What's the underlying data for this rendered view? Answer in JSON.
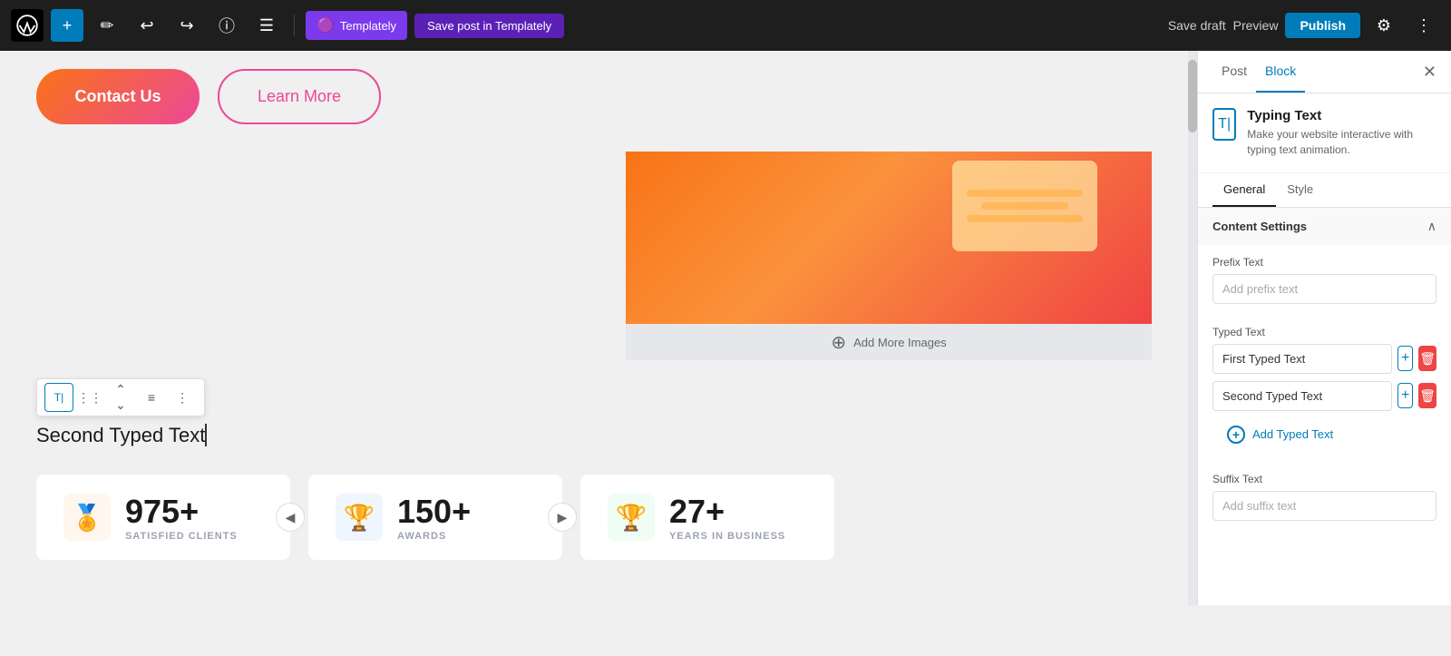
{
  "topbar": {
    "wp_logo": "W",
    "add_label": "+",
    "edit_label": "✏",
    "undo_label": "↩",
    "redo_label": "↪",
    "info_label": "ⓘ",
    "list_label": "☰",
    "templately_label": "Templately",
    "save_post_label": "Save post in Templately",
    "save_draft_label": "Save draft",
    "preview_label": "Preview",
    "publish_label": "Publish"
  },
  "canvas": {
    "contact_us_label": "Contact Us",
    "learn_more_label": "Learn More",
    "add_more_images_label": "Add More Images",
    "typing_text_display": "Second Typed Text",
    "stats": [
      {
        "number": "975+",
        "label": "SATISFIED CLIENTS",
        "icon": "🏅"
      },
      {
        "number": "150+",
        "label": "AWARDS",
        "icon": "🏆"
      },
      {
        "number": "27+",
        "label": "YEARS IN BUSINESS",
        "icon": "🏆"
      }
    ]
  },
  "right_panel": {
    "tab_post": "Post",
    "tab_block": "Block",
    "block_title": "Typing Text",
    "block_desc": "Make your website interactive with typing text animation.",
    "sub_tab_general": "General",
    "sub_tab_style": "Style",
    "content_settings_title": "Content Settings",
    "prefix_text_label": "Prefix Text",
    "prefix_text_placeholder": "Add prefix text",
    "typed_text_label": "Typed Text",
    "typed_text_items": [
      {
        "value": "First Typed Text"
      },
      {
        "value": "Second Typed Text"
      }
    ],
    "add_typed_text_label": "Add Typed Text",
    "suffix_text_label": "Suffix Text",
    "suffix_text_placeholder": "Add suffix text"
  }
}
